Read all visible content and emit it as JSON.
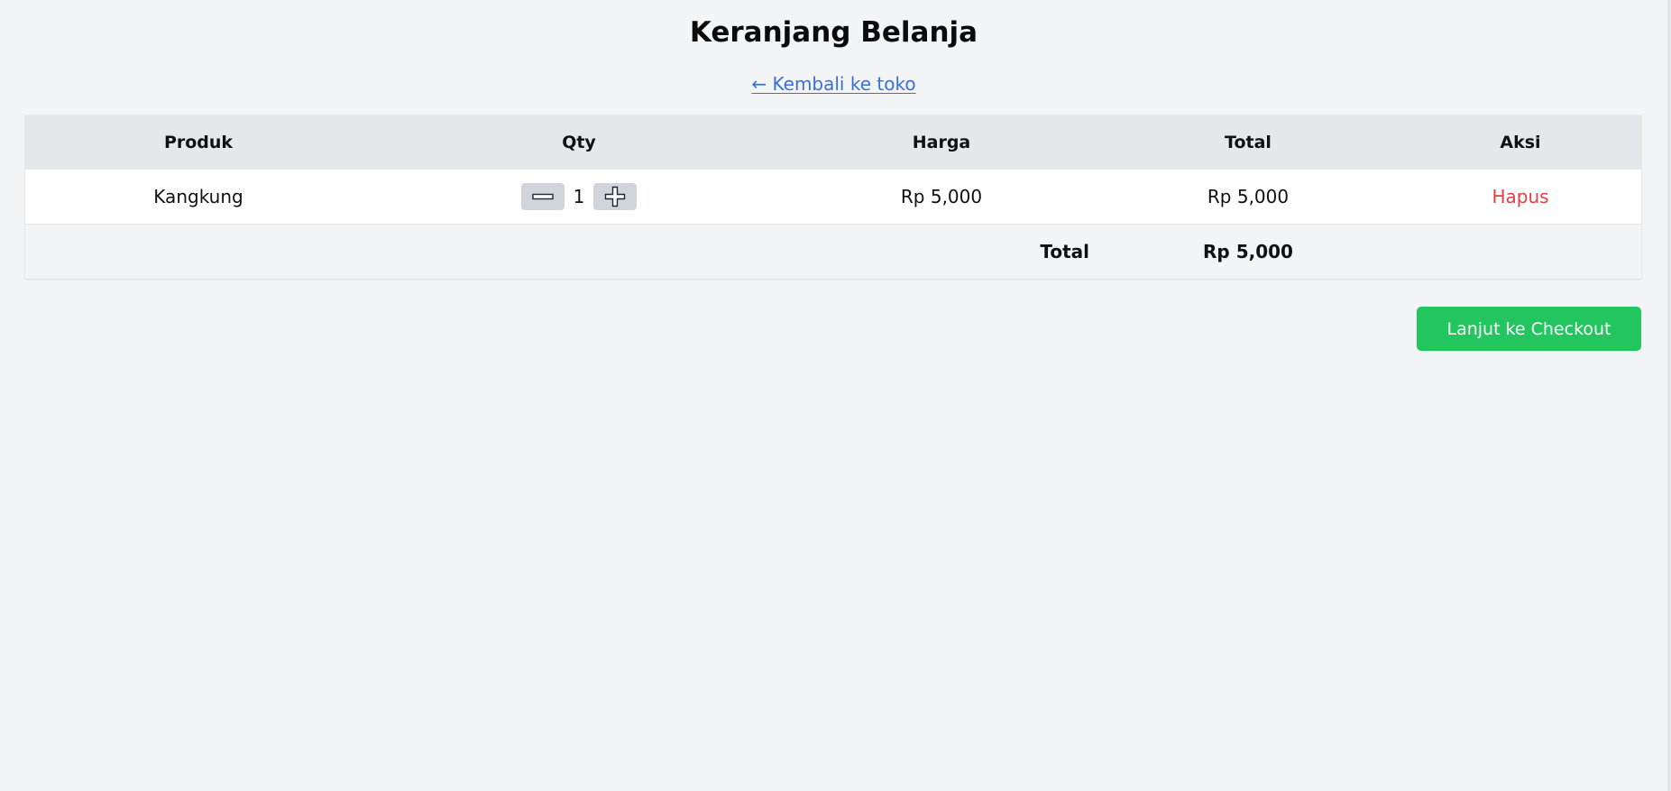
{
  "page": {
    "title": "Keranjang Belanja",
    "back_link": "← Kembali ke toko"
  },
  "table": {
    "headers": {
      "produk": "Produk",
      "qty": "Qty",
      "harga": "Harga",
      "total": "Total",
      "aksi": "Aksi"
    },
    "rows": [
      {
        "produk": "Kangkung",
        "qty": "1",
        "harga": "Rp 5,000",
        "total": "Rp 5,000",
        "aksi": "Hapus"
      }
    ],
    "footer": {
      "label": "Total",
      "value": "Rp 5,000"
    }
  },
  "actions": {
    "checkout": "Lanjut ke Checkout"
  },
  "icons": {
    "decrease": "minus-icon",
    "increase": "plus-icon"
  },
  "colors": {
    "background": "#f3f4f6",
    "header_row": "#e5e7eb",
    "link": "#3b6fd8",
    "delete": "#e53e3e",
    "checkout": "#22c55e",
    "qty_button": "#d1d5db"
  }
}
